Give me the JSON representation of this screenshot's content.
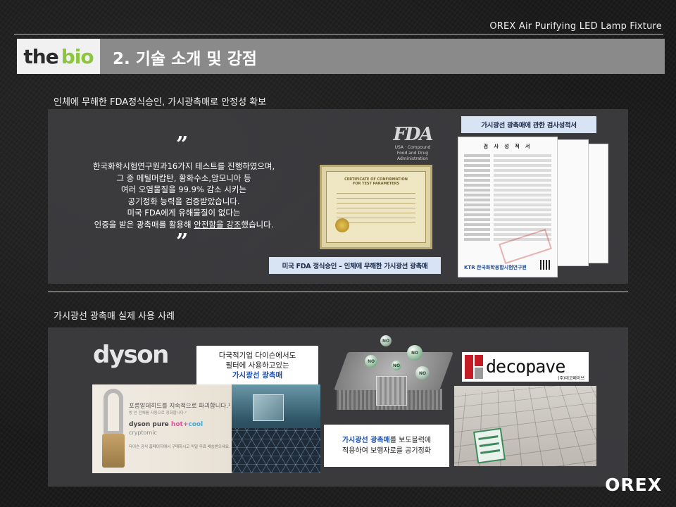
{
  "header": {
    "product_title": "OREX Air Purifying LED Lamp Fixture",
    "logo_the": "the",
    "logo_bio": "bio",
    "section_title": "2. 기술 소개 및 강점"
  },
  "section1": {
    "subtitle": "인체에 무해한 FDA정식승인, 가시광촉매로 안정성 확보",
    "quote_open": "”",
    "quote_close": "”",
    "quote_lines": [
      "한국화학시험연구원과16가지 테스트를 진행하였으며,",
      "그 중 메틸머캅탄, 황화수소,암모니아 등",
      "여러 오염물질을 99.9% 감소 시키는",
      "공기정화 능력을 검증받았습니다.",
      "미국 FDA에게 유해물질이 없다는"
    ],
    "quote_last_prefix": "인증을 받은 광촉매를 활용해 ",
    "quote_last_underlined": "안전함을 강조",
    "quote_last_suffix": "했습니다.",
    "fda_mark": "FDA",
    "fda_sub1": "USA · Compound",
    "fda_sub2": "Food and Drug Administration",
    "cert_title_1": "CERTIFICATE OF CONFIRMATION",
    "cert_title_2": "FOR TEST PARAMETERS",
    "fda_caption": "미국 FDA 정식승인 – 인체에 무해한 가시광선 광촉매",
    "ktr_caption": "가시광선 광촉매에 관한 검사성적서",
    "doc_title": "검 사 성 적 서",
    "doc_footer": "KTR 한국화학융합시험연구원"
  },
  "section2": {
    "subtitle": "가시광선 광촉매 실제 사용 사례",
    "dyson_logo": "dyson",
    "dyson_callout_line1": "다국적기업 다이슨에서도",
    "dyson_callout_line2": "필터에 사용하고있는",
    "dyson_callout_highlight": "가시광선 광촉매",
    "dyson_ad_headline": "포름알데히드를 지속적으로 파괴합니다.¹",
    "dyson_ad_sub": "방 안 전체를 자동으로 정화합니다.²",
    "dyson_ad_brand_a": "dyson pure ",
    "dyson_ad_brand_b": "hot",
    "dyson_ad_brand_c": "+",
    "dyson_ad_brand_d": "cool",
    "dyson_ad_model": "cryptomic",
    "dyson_ad_footer": "다이슨 공식 홈페이지에서 구매하시고 익일 무료 배송받으세요.",
    "block_callout_highlight": "가시광선 광촉매",
    "block_callout_line1_rest": "를 보도블럭에",
    "block_callout_line2": "적용하여 보행자로를 공기정화",
    "bubble_label": "NO",
    "deco_logo": "decopave",
    "deco_sub": "(주)데코페이브"
  },
  "footer": {
    "brand": "OREX"
  }
}
